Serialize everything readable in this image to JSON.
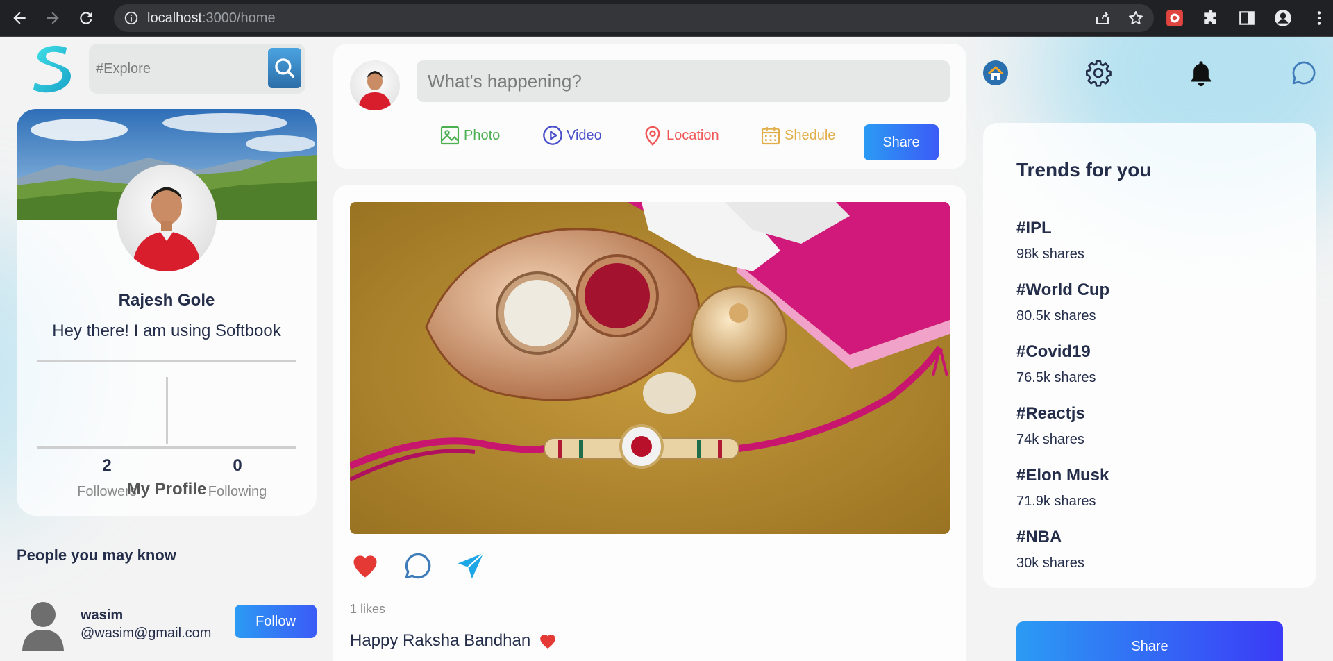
{
  "browser": {
    "url_host": "localhost",
    "url_path": ":3000/home"
  },
  "search": {
    "placeholder": "#Explore"
  },
  "profile": {
    "name": "Rajesh Gole",
    "bio": "Hey there! I am using Softbook",
    "followers_count": "2",
    "followers_label": "Followers",
    "following_count": "0",
    "following_label": "Following",
    "my_profile_label": "My Profile"
  },
  "people": {
    "title": "People you may know",
    "items": [
      {
        "name": "wasim",
        "email": "@wasim@gmail.com",
        "follow_label": "Follow"
      }
    ]
  },
  "composer": {
    "placeholder": "What's happening?",
    "options": [
      {
        "label": "Photo",
        "color": "#4caf50",
        "icon": "image-icon"
      },
      {
        "label": "Video",
        "color": "#4a4fc9",
        "icon": "play-circle-icon"
      },
      {
        "label": "Location",
        "color": "#ef5757",
        "icon": "location-pin-icon"
      },
      {
        "label": "Shedule",
        "color": "#e1ae4a",
        "icon": "calendar-icon"
      }
    ],
    "share_label": "Share"
  },
  "post": {
    "likes": "1 likes",
    "caption": "Happy Raksha Bandhan"
  },
  "trends": {
    "title": "Trends for you",
    "items": [
      {
        "name": "#IPL",
        "shares": "98k shares"
      },
      {
        "name": "#World Cup",
        "shares": "80.5k shares"
      },
      {
        "name": "#Covid19",
        "shares": "76.5k shares"
      },
      {
        "name": "#Reactjs",
        "shares": "74k shares"
      },
      {
        "name": "#Elon Musk",
        "shares": "71.9k shares"
      },
      {
        "name": "#NBA",
        "shares": "30k shares"
      }
    ],
    "share_label": "Share"
  },
  "colors": {
    "accent_gradient_start": "#2b9bf4",
    "accent_gradient_end": "#3b5bf6",
    "text_dark": "#242d49",
    "like_red": "#e53935"
  }
}
